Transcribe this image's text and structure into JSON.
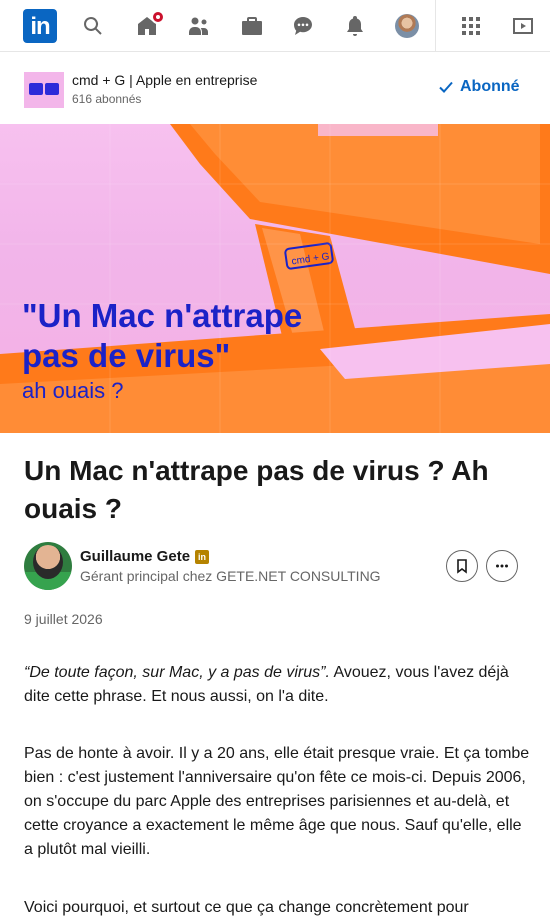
{
  "nav": {
    "logo_text": "in",
    "icons": [
      "search-icon",
      "home-icon",
      "network-icon",
      "jobs-icon",
      "messaging-icon",
      "notifications-icon",
      "profile-avatar",
      "apps-grid-icon",
      "learning-icon"
    ],
    "accent": "#0a66c2",
    "notification_color": "#cb112d"
  },
  "company": {
    "name": "cmd + G | Apple en entreprise",
    "followers": "616 abonnés",
    "follow_label": "Abonné"
  },
  "hero": {
    "title_line1": "\"Un Mac n'attrape",
    "title_line2": "pas de virus\"",
    "subtitle": "ah ouais ?",
    "badge": "cmd + G",
    "text_color": "#1b22c7",
    "background": "#f4b7ea",
    "accent": "#ff7a1a"
  },
  "article": {
    "title": "Un Mac n'attrape pas de virus ? Ah ouais ?",
    "author_name": "Guillaume Gete",
    "author_badge": "in",
    "author_role": "Gérant principal chez GETE.NET CONSULTING",
    "date": "9 juillet 2026",
    "p1_quote": "“De toute façon, sur Mac, y a pas de virus”.",
    "p1_rest": " Avouez, vous l'avez déjà dite cette phrase. Et nous aussi, on l'a dite.",
    "p2": "Pas de honte à avoir. Il y a 20 ans, elle était presque vraie. Et ça tombe bien : c'est justement l'anniversaire qu'on fête ce mois-ci. Depuis 2006, on s'occupe du parc Apple des entreprises parisiennes et au-delà, et cette croyance a exactement le même âge que nous. Sauf qu'elle, elle a plutôt mal vieilli.",
    "p3": "Voici pourquoi, et surtout ce que ça change concrètement pour"
  }
}
